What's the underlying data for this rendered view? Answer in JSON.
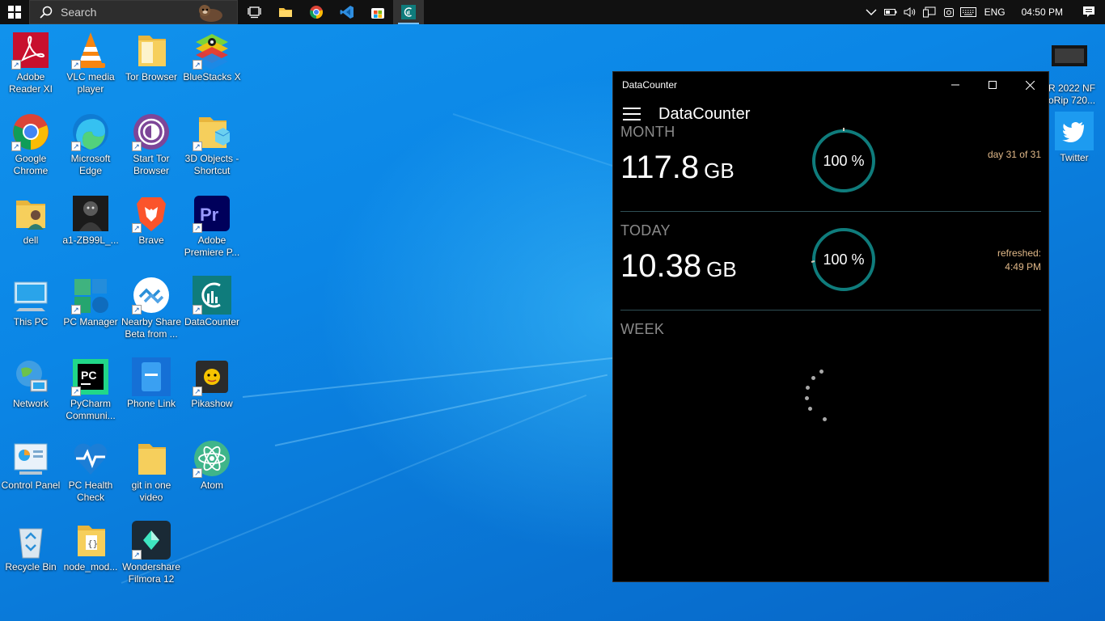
{
  "taskbar": {
    "search_label": "Search",
    "language": "ENG",
    "time": "04:50 PM",
    "apps": [
      "task-view",
      "file-explorer",
      "chrome",
      "vscode",
      "microsoft-store",
      "datacounter"
    ]
  },
  "desktop": {
    "icons": [
      {
        "label": "Adobe Reader XI"
      },
      {
        "label": "VLC media player"
      },
      {
        "label": "Tor Browser"
      },
      {
        "label": "BlueStacks X"
      },
      {
        "label": "Google Chrome"
      },
      {
        "label": "Microsoft Edge"
      },
      {
        "label": "Start Tor Browser"
      },
      {
        "label": "3D Objects - Shortcut"
      },
      {
        "label": "dell"
      },
      {
        "label": "a1-ZB99L_..."
      },
      {
        "label": "Brave"
      },
      {
        "label": "Adobe Premiere P..."
      },
      {
        "label": "This PC"
      },
      {
        "label": "PC Manager"
      },
      {
        "label": "Nearby Share Beta from ..."
      },
      {
        "label": "DataCounter"
      },
      {
        "label": "Network"
      },
      {
        "label": "PyCharm Communi..."
      },
      {
        "label": "Phone Link"
      },
      {
        "label": "Pikashow"
      },
      {
        "label": "Control Panel"
      },
      {
        "label": "PC Health Check"
      },
      {
        "label": "git in one video"
      },
      {
        "label": "Atom"
      },
      {
        "label": "Recycle Bin"
      },
      {
        "label": "node_mod..."
      },
      {
        "label": "Wondershare Filmora 12"
      }
    ],
    "partial": {
      "video_label_1": "R 2022 NF",
      "video_label_2": "oRip 720...",
      "twitter_label": "Twitter"
    }
  },
  "window": {
    "title": "DataCounter",
    "app_title": "DataCounter",
    "month": {
      "label": "MONTH",
      "value": "117.8",
      "unit": "GB",
      "percent": "100 %",
      "percent_value": 100,
      "note": "day 31 of 31"
    },
    "today": {
      "label": "TODAY",
      "value": "10.38",
      "unit": "GB",
      "percent": "100 %",
      "percent_value": 100,
      "note_1": "refreshed:",
      "note_2": "4:49 PM"
    },
    "week": {
      "label": "WEEK"
    },
    "colors": {
      "ring": "#0f7c7c",
      "note": "#e0b888",
      "label": "#8a8a8a"
    }
  }
}
